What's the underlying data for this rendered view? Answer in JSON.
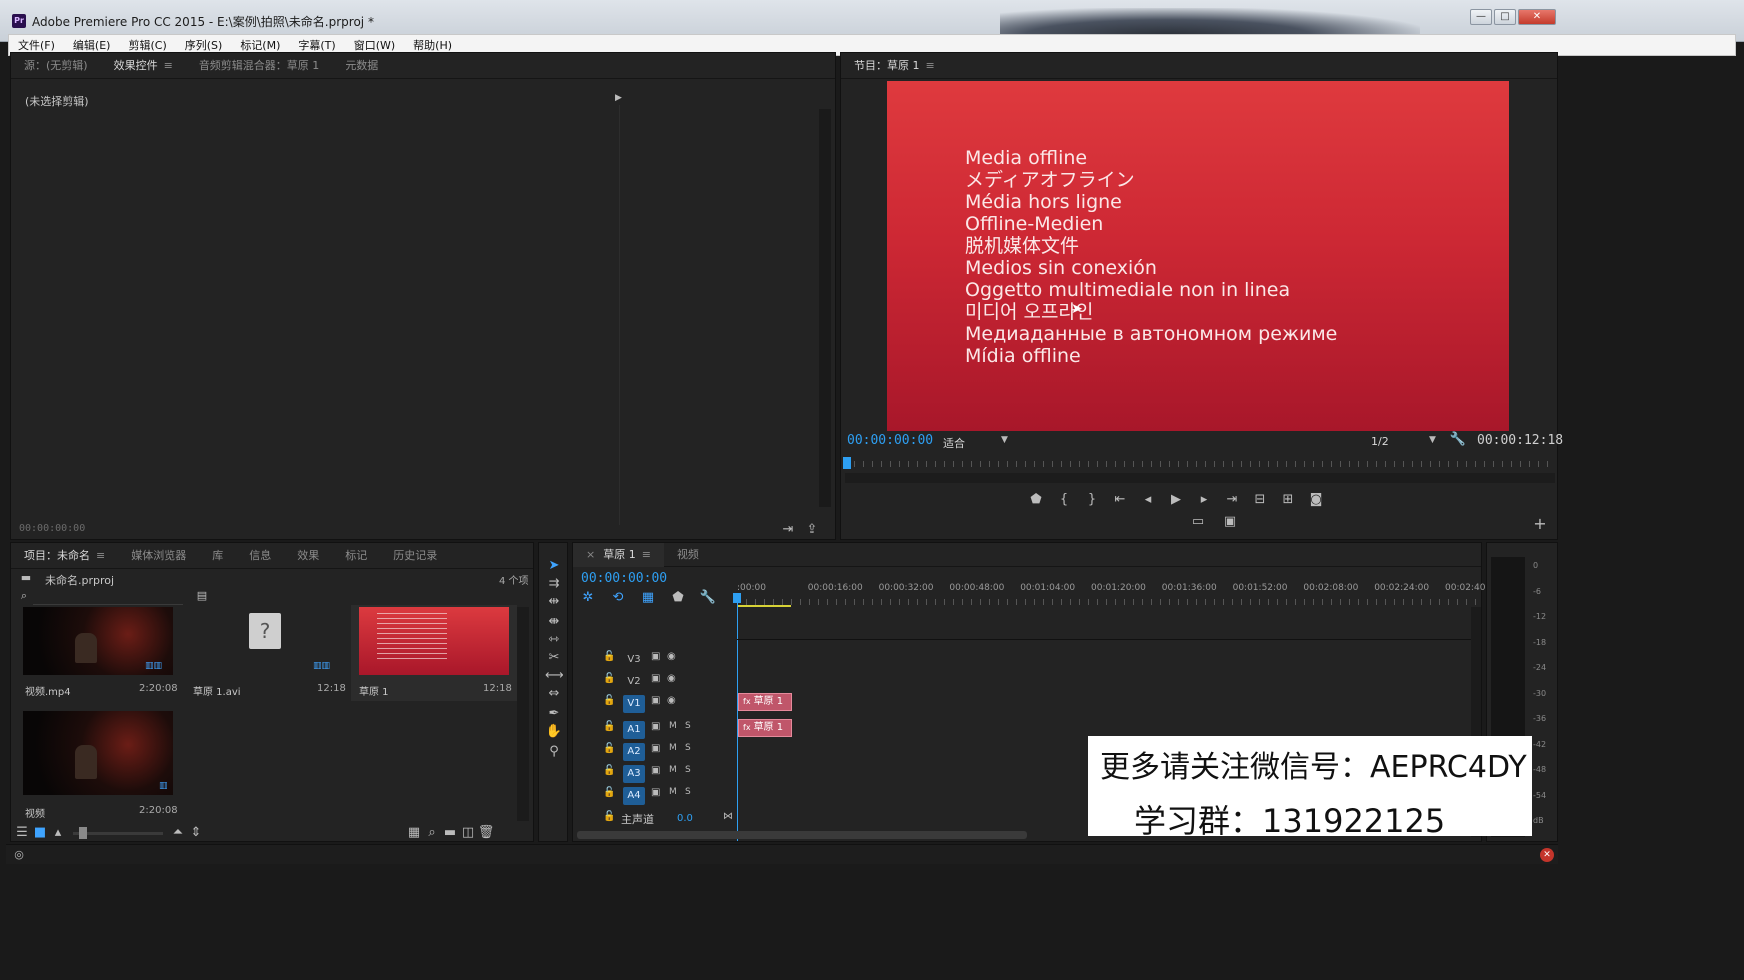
{
  "window": {
    "title": "Adobe Premiere Pro CC 2015 - E:\\案例\\拍照\\未命名.prproj *",
    "logo": "Pr",
    "minimize": "—",
    "maximize": "□",
    "close": "✕"
  },
  "menu": [
    "文件(F)",
    "编辑(E)",
    "剪辑(C)",
    "序列(S)",
    "标记(M)",
    "字幕(T)",
    "窗口(W)",
    "帮助(H)"
  ],
  "source_panel": {
    "tabs": [
      "源：(无剪辑)",
      "效果控件",
      "音频剪辑混合器：草原 1",
      "元数据"
    ],
    "active_tab_index": 1,
    "no_clip_label": "(未选择剪辑)",
    "timecode": "00:00:00:00"
  },
  "program_panel": {
    "tab": "节目：草原 1",
    "offline_lines": [
      "Media offline",
      "メディアオフライン",
      "Média hors ligne",
      "Offline-Medien",
      "脱机媒体文件",
      "Medios sin conexión",
      "Oggetto multimediale non in linea",
      "미디어 오프라인",
      "Медиаданные в автономном режиме",
      "Mídia offline"
    ],
    "current_timecode": "00:00:00:00",
    "zoom": "适合",
    "resolution": "1/2",
    "duration": "00:00:12:18",
    "playhead_fraction": 0.0
  },
  "project_panel": {
    "tabs": [
      "项目：未命名",
      "媒体浏览器",
      "库",
      "信息",
      "效果",
      "标记",
      "历史记录"
    ],
    "project_file": "未命名.prproj",
    "item_count": "4 个项",
    "items": [
      {
        "name": "视频.mp4",
        "duration": "2:20:08"
      },
      {
        "name": "草原 1.avi",
        "duration": "12:18"
      },
      {
        "name": "草原 1",
        "duration": "12:18"
      },
      {
        "name": "视频",
        "duration": "2:20:08"
      }
    ]
  },
  "timeline": {
    "tabs": [
      "草原 1",
      "视频"
    ],
    "timecode": "00:00:00:00",
    "ruler": [
      ":00:00",
      "00:00:16:00",
      "00:00:32:00",
      "00:00:48:00",
      "00:01:04:00",
      "00:01:20:00",
      "00:01:36:00",
      "00:01:52:00",
      "00:02:08:00",
      "00:02:24:00",
      "00:02:40:0"
    ],
    "video_tracks": [
      "V3",
      "V2",
      "V1"
    ],
    "audio_tracks": [
      "A1",
      "A2",
      "A3",
      "A4"
    ],
    "master": {
      "label": "主声道",
      "value": "0.0"
    },
    "clips": {
      "video": "草原 1",
      "audio": "草原 1"
    },
    "track_mute": "M",
    "track_solo": "S"
  },
  "meter": {
    "labels": [
      "0",
      "-6",
      "-12",
      "-18",
      "-24",
      "-30",
      "-36",
      "-42",
      "-48",
      "-54",
      "dB"
    ]
  },
  "watermark": {
    "line1": "更多请关注微信号：AEPRC4DY",
    "line2": "学习群：131922125"
  },
  "colors": {
    "accent": "#2e9ff2",
    "clip": "#c0566a",
    "offline_red": "#c2222e"
  }
}
